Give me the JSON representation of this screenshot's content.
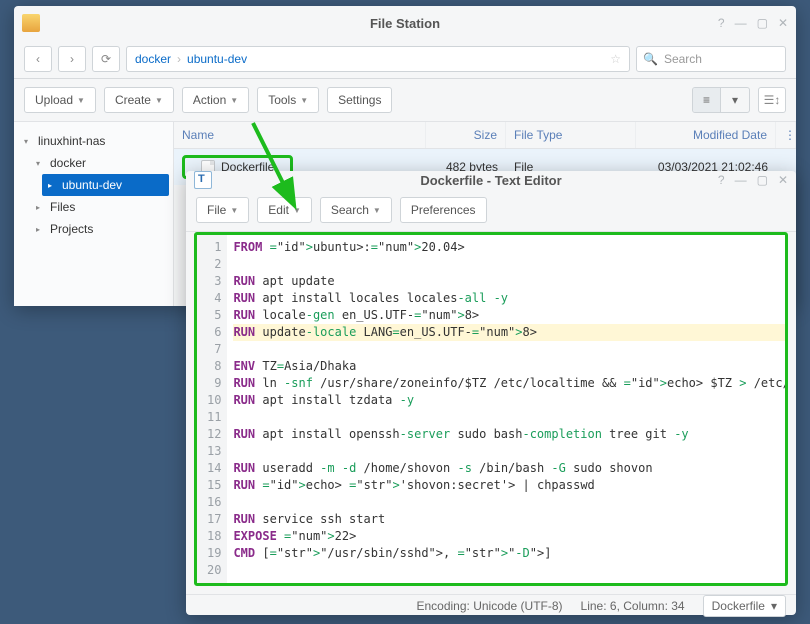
{
  "filestation": {
    "title": "File Station",
    "breadcrumb": [
      "docker",
      "ubuntu-dev"
    ],
    "search_placeholder": "Search",
    "toolbar": {
      "upload": "Upload",
      "create": "Create",
      "action": "Action",
      "tools": "Tools",
      "settings": "Settings"
    },
    "tree": {
      "root": "linuxhint-nas",
      "items": [
        {
          "label": "docker",
          "expanded": true,
          "children": [
            {
              "label": "ubuntu-dev",
              "selected": true
            }
          ]
        },
        {
          "label": "Files"
        },
        {
          "label": "Projects"
        }
      ]
    },
    "columns": {
      "name": "Name",
      "size": "Size",
      "type": "File Type",
      "date": "Modified Date"
    },
    "file": {
      "name": "Dockerfile",
      "size": "482 bytes",
      "type": "File",
      "date": "03/03/2021 21:02:46"
    }
  },
  "editor": {
    "title": "Dockerfile - Text Editor",
    "menu": {
      "file": "File",
      "edit": "Edit",
      "search": "Search",
      "prefs": "Preferences"
    },
    "code_lines": [
      {
        "n": 1,
        "t": "FROM ubuntu:20.04"
      },
      {
        "n": 2,
        "t": ""
      },
      {
        "n": 3,
        "t": "RUN apt update"
      },
      {
        "n": 4,
        "t": "RUN apt install locales locales-all -y"
      },
      {
        "n": 5,
        "t": "RUN locale-gen en_US.UTF-8"
      },
      {
        "n": 6,
        "t": "RUN update-locale LANG=en_US.UTF-8",
        "hl": true
      },
      {
        "n": 7,
        "t": ""
      },
      {
        "n": 8,
        "t": "ENV TZ=Asia/Dhaka"
      },
      {
        "n": 9,
        "t": "RUN ln -snf /usr/share/zoneinfo/$TZ /etc/localtime && echo $TZ > /etc/timezone"
      },
      {
        "n": 10,
        "t": "RUN apt install tzdata -y"
      },
      {
        "n": 11,
        "t": ""
      },
      {
        "n": 12,
        "t": "RUN apt install openssh-server sudo bash-completion tree git -y"
      },
      {
        "n": 13,
        "t": ""
      },
      {
        "n": 14,
        "t": "RUN useradd -m -d /home/shovon -s /bin/bash -G sudo shovon"
      },
      {
        "n": 15,
        "t": "RUN echo 'shovon:secret' | chpasswd"
      },
      {
        "n": 16,
        "t": ""
      },
      {
        "n": 17,
        "t": "RUN service ssh start"
      },
      {
        "n": 18,
        "t": "EXPOSE 22"
      },
      {
        "n": 19,
        "t": "CMD [\"/usr/sbin/sshd\", \"-D\"]"
      },
      {
        "n": 20,
        "t": ""
      }
    ],
    "status": {
      "encoding": "Encoding: Unicode (UTF-8)",
      "pos": "Line: 6, Column: 34",
      "lang": "Dockerfile"
    }
  }
}
